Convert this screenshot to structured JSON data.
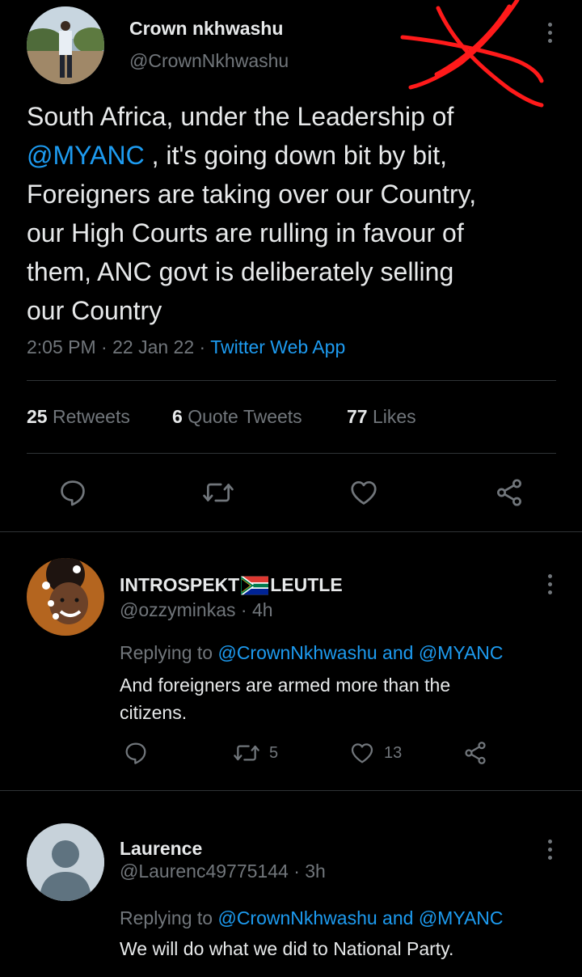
{
  "main_tweet": {
    "author_name": "Crown nkhwashu",
    "author_handle": "@CrownNkhwashu",
    "text_lines": [
      "South Africa, under the Leadership of",
      ", it's going down bit by bit,",
      "Foreigners are taking over our Country,",
      "our High Courts are rulling in favour of",
      "them, ANC govt is deliberately selling",
      "our Country"
    ],
    "mention": "@MYANC",
    "time": "2:05 PM",
    "date": "22 Jan 22",
    "separator": "·",
    "source": "Twitter Web App",
    "retweets_count": "25",
    "retweets_label": "Retweets",
    "quotes_count": "6",
    "quotes_label": "Quote Tweets",
    "likes_count": "77",
    "likes_label": "Likes"
  },
  "replies": [
    {
      "name_part1": "INTROSPEKT",
      "name_part2": "LEUTLE",
      "handle": "@ozzyminkas",
      "time": "· 4h",
      "replying_prefix": "Replying to",
      "replying_targets": "@CrownNkhwashu and @MYANC",
      "text_lines": [
        "And foreigners are armed more than the",
        "citizens."
      ],
      "retweets": "5",
      "likes": "13"
    },
    {
      "name": "Laurence",
      "handle": "@Laurenc49775144",
      "time": "· 3h",
      "replying_prefix": "Replying to",
      "replying_targets": "@CrownNkhwashu and @MYANC",
      "text_lines": [
        "We will do what we did to National Party."
      ]
    }
  ],
  "colors": {
    "background": "#000000",
    "text": "#e7e9ea",
    "muted": "#71767b",
    "accent": "#1d9bf0",
    "divider": "#2f3336",
    "scribble": "#ff1a1a"
  },
  "icons": [
    "more-icon",
    "reply-icon",
    "retweet-icon",
    "like-icon",
    "share-icon",
    "south-africa-flag-icon",
    "default-avatar-icon"
  ]
}
